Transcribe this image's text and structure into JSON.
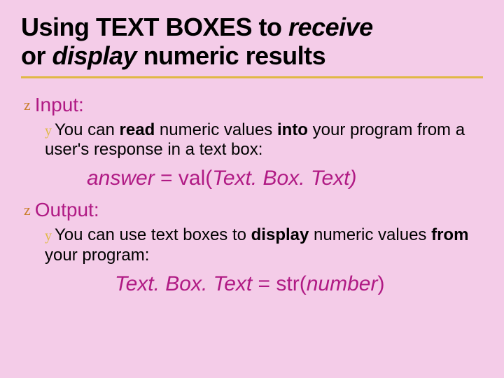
{
  "title": {
    "p1": "Using TEXT BOXES to ",
    "p2": "receive",
    "p3": "or ",
    "p4": "display",
    "p5": " numeric results"
  },
  "input": {
    "heading": "Input:",
    "line_a": "You can ",
    "line_b": "read",
    "line_c": " numeric values ",
    "line_d": "into",
    "line_e": " your program from a user's response in a text box:",
    "code_a": "answer",
    "code_b": " = ",
    "code_c": "val(",
    "code_d": "Text. Box. Text)"
  },
  "output": {
    "heading": "Output:",
    "line_a": "You can use text boxes to ",
    "line_b": "display",
    "line_c": " numeric values ",
    "line_d": "from",
    "line_e": " your program:",
    "code_a": "Text. Box. Text",
    "code_b": " = ",
    "code_c": "str(",
    "code_d": "number",
    "code_e": ")"
  },
  "bullets": {
    "z": "z",
    "y": "y"
  }
}
